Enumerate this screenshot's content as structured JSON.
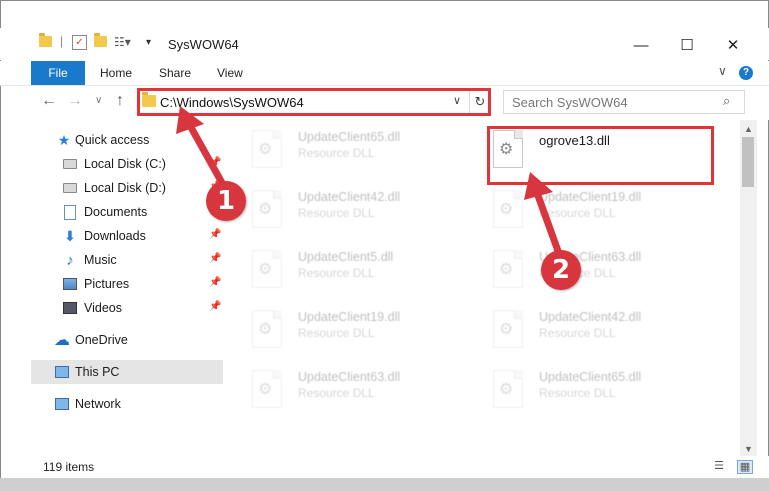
{
  "window": {
    "title": "SysWOW64",
    "minimize_glyph": "—",
    "maximize_glyph": "☐",
    "close_glyph": "✕"
  },
  "ribbon": {
    "tabs": [
      "File",
      "Home",
      "Share",
      "View"
    ],
    "help_glyph": "?",
    "expand_glyph": "∨"
  },
  "nav": {
    "back_glyph": "←",
    "forward_glyph": "→",
    "recent_glyph": "∨",
    "up_glyph": "↑",
    "address": "C:\\Windows\\SysWOW64",
    "address_dropdown_glyph": "∨",
    "refresh_glyph": "↻",
    "search_placeholder": "Search SysWOW64",
    "search_glyph": "⌕"
  },
  "sidebar": {
    "items": [
      {
        "label": "Quick access",
        "icon": "star-icon",
        "pinned": false
      },
      {
        "label": "Local Disk (C:)",
        "icon": "drive-icon",
        "pinned": true
      },
      {
        "label": "Local Disk (D:)",
        "icon": "drive-icon",
        "pinned": true
      },
      {
        "label": "Documents",
        "icon": "documents-icon",
        "pinned": true
      },
      {
        "label": "Downloads",
        "icon": "downloads-icon",
        "pinned": true
      },
      {
        "label": "Music",
        "icon": "music-icon",
        "pinned": true
      },
      {
        "label": "Pictures",
        "icon": "pictures-icon",
        "pinned": true
      },
      {
        "label": "Videos",
        "icon": "videos-icon",
        "pinned": true
      },
      {
        "label": "OneDrive",
        "icon": "onedrive-icon",
        "pinned": false
      },
      {
        "label": "This PC",
        "icon": "computer-icon",
        "pinned": false,
        "selected": true
      },
      {
        "label": "Network",
        "icon": "network-icon",
        "pinned": false
      }
    ],
    "pin_glyph": "📌"
  },
  "files": {
    "left_column": [
      {
        "name": "UpdateClient65.dll",
        "type": "Resource DLL"
      },
      {
        "name": "UpdateClient42.dll",
        "type": "Resource DLL"
      },
      {
        "name": "UpdateClient5.dll",
        "type": "Resource DLL"
      },
      {
        "name": "UpdateClient19.dll",
        "type": "Resource DLL"
      },
      {
        "name": "UpdateClient63.dll",
        "type": "Resource DLL"
      }
    ],
    "highlighted": {
      "name": "ogrove13.dll",
      "type": ""
    },
    "right_column": [
      {
        "name": "UpdateClient19.dll",
        "type": "Resource DLL"
      },
      {
        "name": "UpdateClient63.dll",
        "type": "Resource DLL"
      },
      {
        "name": "UpdateClient42.dll",
        "type": "Resource DLL"
      },
      {
        "name": "UpdateClient65.dll",
        "type": "Resource DLL"
      }
    ]
  },
  "status": {
    "item_count": "119 items"
  },
  "annotations": {
    "step1": "1",
    "step2": "2",
    "color": "#d7363e"
  },
  "colors": {
    "accent": "#1979ca",
    "highlight_box": "#e0343a",
    "folder": "#f2c94c"
  }
}
